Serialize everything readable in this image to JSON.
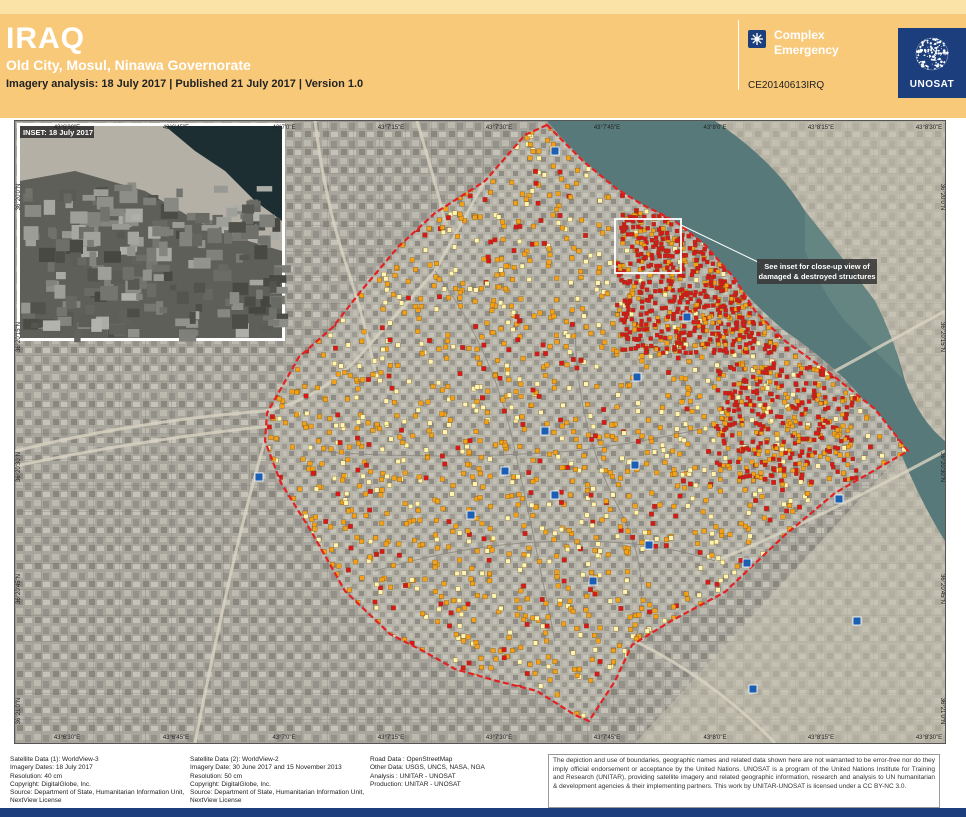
{
  "header": {
    "title": "IRAQ",
    "subtitle": "Old City, Mosul, Ninawa Governorate",
    "meta": "Imagery analysis: 18 July 2017 | Published 21 July 2017 | Version 1.0",
    "category": "Complex Emergency",
    "code": "CE20140613IRQ",
    "logo_text": "UNOSAT"
  },
  "map": {
    "inset_label": "INSET: 18 July 2017",
    "callout_line1": "See inset for close-up view of",
    "callout_line2": "damaged & destroyed structures",
    "top_ticks": [
      "43°6'30\"E",
      "43°6'45\"E",
      "43°7'0\"E",
      "43°7'15\"E",
      "43°7'30\"E",
      "43°7'45\"E",
      "43°8'0\"E",
      "43°8'15\"E",
      "43°8'30\"E"
    ],
    "bottom_ticks": [
      "43°6'30\"E",
      "43°6'45\"E",
      "43°7'0\"E",
      "43°7'15\"E",
      "43°7'30\"E",
      "43°7'45\"E",
      "43°8'0\"E",
      "43°8'15\"E",
      "43°8'30\"E"
    ],
    "left_ticks": [
      "36°21'0\"N",
      "36°20'45\"N",
      "36°20'30\"N",
      "36°20'15\"N",
      "36°20'0\"N"
    ],
    "right_ticks": [
      "36°21'0\"N",
      "36°20'45\"N",
      "36°20'30\"N",
      "36°20'15\"N",
      "36°20'0\"N"
    ],
    "colors": {
      "destroyed": "#d7191c",
      "severe": "#f2a018",
      "moderate": "#fff5b0",
      "boundary": "#e32222",
      "river": "#58797a"
    }
  },
  "footer": {
    "col1": [
      "Satellite Data (1): WorldView-3",
      "Imagery Dates: 18 July 2017",
      "Resolution: 40 cm",
      "Copyright: DigitalGlobe, Inc.",
      "Source: Department of State, Humanitarian Information Unit,",
      "NextView License"
    ],
    "col2": [
      "Satellite Data (2): WorldView-2",
      "Imagery Date: 30 June 2017 and 15 November 2013",
      "Resolution: 50 cm",
      "Copyright: DigitalGlobe, Inc.",
      "Source: Department of State, Humanitarian Information Unit,",
      "NextView License"
    ],
    "col3": [
      "Road Data : OpenStreetMap",
      "Other Data: USGS, UNCS, NASA, NGA",
      "Analysis : UNITAR - UNOSAT",
      "Production: UNITAR - UNOSAT"
    ],
    "disclaimer": "The depiction and use of boundaries, geographic names and related data shown here are not warranted to be error-free nor do they imply official endorsement or acceptance by the United Nations. UNOSAT is a program of the United Nations Institute for Training and Research (UNITAR), providing satellite imagery and related geographic information, research and analysis to UN humanitarian & development agencies & their implementing partners. This work by UNITAR-UNOSAT is licensed under a CC BY-NC 3.0."
  }
}
